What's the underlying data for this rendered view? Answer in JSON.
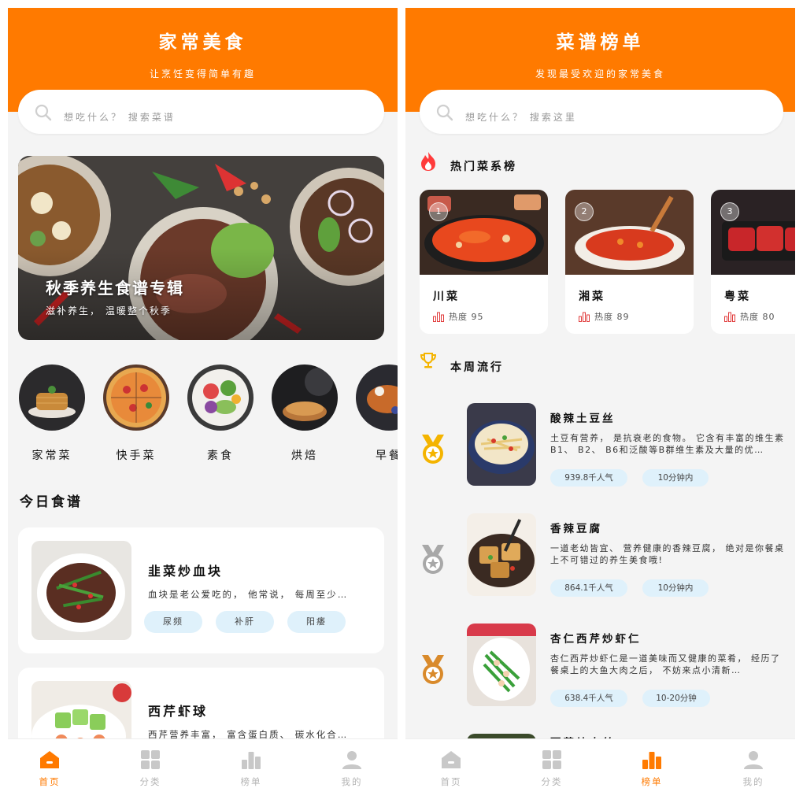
{
  "home": {
    "header": {
      "title": "家常美食",
      "subtitle": "让烹饪变得简单有趣"
    },
    "search": {
      "placeholder": "想吃什么？ 搜索菜谱"
    },
    "banner": {
      "title": "秋季养生食谱专辑",
      "subtitle": "滋补养生， 温暖整个秋季"
    },
    "categories": [
      {
        "label": "家常菜"
      },
      {
        "label": "快手菜"
      },
      {
        "label": "素食"
      },
      {
        "label": "烘焙"
      },
      {
        "label": "早餐"
      }
    ],
    "section_title": "今日食谱",
    "recipes": [
      {
        "title": "韭菜炒血块",
        "desc": "血块是老公爱吃的， 他常说， 每周至少…",
        "tags": [
          "尿频",
          "补肝",
          "阳痿"
        ]
      },
      {
        "title": "西芹虾球",
        "desc": "西芹营养丰富， 富含蛋白质、 碳水化合…",
        "tags": []
      }
    ]
  },
  "ranking": {
    "header": {
      "title": "菜谱榜单",
      "subtitle": "发现最受欢迎的家常美食"
    },
    "search": {
      "placeholder": "想吃什么？ 搜索这里"
    },
    "hot_title": "热门菜系榜",
    "cuisines": [
      {
        "rank": "1",
        "name": "川菜",
        "heat": "热度 95"
      },
      {
        "rank": "2",
        "name": "湘菜",
        "heat": "热度 89"
      },
      {
        "rank": "3",
        "name": "粤菜",
        "heat": "热度 80"
      }
    ],
    "trend_title": "本周流行",
    "trending": [
      {
        "name": "酸辣土豆丝",
        "desc": "土豆有营养， 是抗衰老的食物。 它含有丰富的维生素B1、 B2、 B6和泛酸等B群维生素及大量的优…",
        "popularity": "939.8千人气",
        "time": "10分钟内",
        "medal": "gold"
      },
      {
        "name": "香辣豆腐",
        "desc": "一道老幼皆宜、 营养健康的香辣豆腐， 绝对是你餐桌上不可错过的养生美食哦!",
        "popularity": "864.1千人气",
        "time": "10分钟内",
        "medal": "silver"
      },
      {
        "name": "杏仁西芹炒虾仁",
        "desc": "杏仁西芹炒虾仁是一道美味而又健康的菜肴， 经历了餐桌上的大鱼大肉之后， 不妨来点小清新…",
        "popularity": "638.4千人气",
        "time": "10-20分钟",
        "medal": "bronze"
      }
    ],
    "next_item": "西芹炒肉丝"
  },
  "nav": {
    "home": "首页",
    "category": "分类",
    "ranking": "榜单",
    "mine": "我的"
  },
  "colors": {
    "accent": "#ff7a00",
    "tag_bg": "#dff1fb",
    "gold": "#f4b400",
    "silver": "#a8a8a8",
    "bronze": "#d98a2b"
  }
}
